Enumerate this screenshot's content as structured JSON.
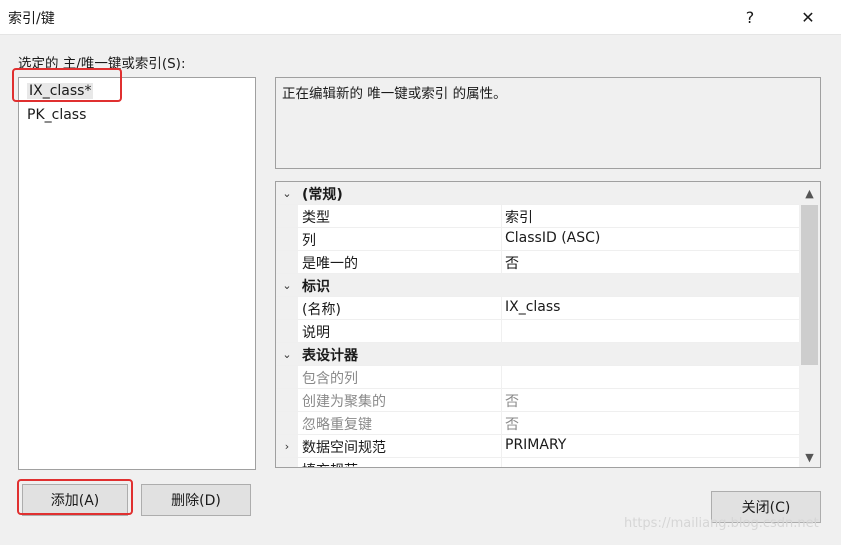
{
  "window": {
    "title": "索引/键",
    "help_glyph": "?",
    "close_glyph": "✕"
  },
  "left": {
    "label": "选定的 主/唯一键或索引(S):",
    "items": [
      "IX_class*",
      "PK_class"
    ]
  },
  "description": "正在编辑新的 唯一键或索引 的属性。",
  "grid": {
    "rows": [
      {
        "type": "cat",
        "name": "(常规)"
      },
      {
        "type": "prop",
        "name": "类型",
        "value": "索引"
      },
      {
        "type": "prop",
        "name": "列",
        "value": "ClassID (ASC)"
      },
      {
        "type": "prop",
        "name": "是唯一的",
        "value": "否"
      },
      {
        "type": "cat",
        "name": "标识"
      },
      {
        "type": "prop",
        "name": "(名称)",
        "value": "IX_class"
      },
      {
        "type": "prop",
        "name": "说明",
        "value": ""
      },
      {
        "type": "cat",
        "name": "表设计器"
      },
      {
        "type": "dis",
        "name": "包含的列",
        "value": ""
      },
      {
        "type": "dis",
        "name": "创建为聚集的",
        "value": "否"
      },
      {
        "type": "dis",
        "name": "忽略重复键",
        "value": "否"
      },
      {
        "type": "sub",
        "name": "数据空间规范",
        "value": "PRIMARY"
      },
      {
        "type": "sub",
        "name": "填充规范",
        "value": ""
      }
    ]
  },
  "buttons": {
    "add": "添加(A)",
    "delete": "删除(D)",
    "close": "关闭(C)"
  },
  "watermark": "https://mailiang.blog.csdn.net",
  "colors": {
    "highlight": "#e03030",
    "bg": "#f0f0f0"
  }
}
